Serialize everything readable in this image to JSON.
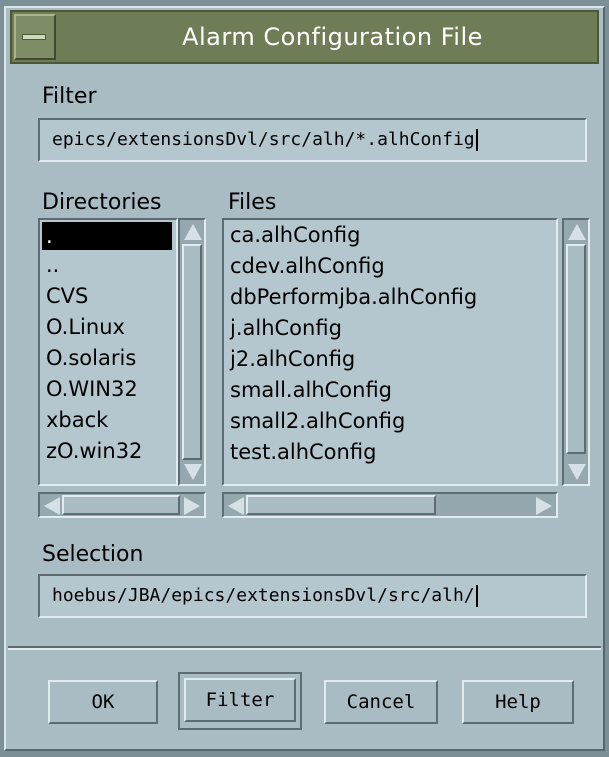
{
  "window": {
    "title": "Alarm Configuration File"
  },
  "filter": {
    "label": "Filter",
    "value": "epics/extensionsDvl/src/alh/*.alhConfig"
  },
  "directories": {
    "label": "Directories",
    "items": [
      ".",
      "..",
      "CVS",
      "O.Linux",
      "O.solaris",
      "O.WIN32",
      "xback",
      "zO.win32"
    ],
    "selected_index": 0
  },
  "files": {
    "label": "Files",
    "items": [
      "ca.alhConfig",
      "cdev.alhConfig",
      "dbPerformjba.alhConfig",
      "j.alhConfig",
      "j2.alhConfig",
      "small.alhConfig",
      "small2.alhConfig",
      "test.alhConfig"
    ]
  },
  "selection": {
    "label": "Selection",
    "value": "hoebus/JBA/epics/extensionsDvl/src/alh/"
  },
  "buttons": {
    "ok": "OK",
    "filter": "Filter",
    "cancel": "Cancel",
    "help": "Help"
  },
  "colors": {
    "background": "#a9bcc4",
    "titlebar": "#6f7d56",
    "field": "#b5c7ce"
  }
}
